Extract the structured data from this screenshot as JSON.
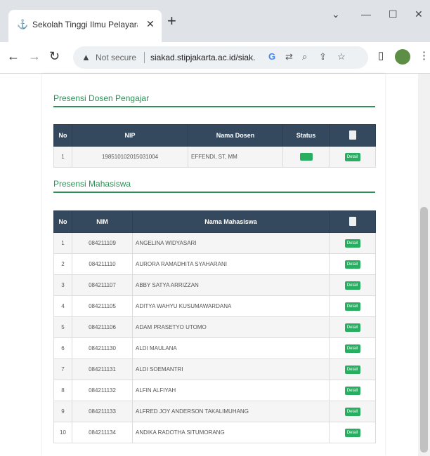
{
  "browser": {
    "tab_title": "Sekolah Tinggi Ilmu Pelayaran J...",
    "tab_favicon": "anchor-icon",
    "new_tab_symbol": "+",
    "not_secure_label": "Not secure",
    "url": "siakad.stipjakarta.ac.id/siak..."
  },
  "page": {
    "dosen_section_title": "Presensi Dosen Pengajar",
    "mahasiswa_section_title": "Presensi Mahasiswa",
    "dosen_table": {
      "headers": {
        "no": "No",
        "nip": "NIP",
        "nama": "Nama Dosen",
        "status": "Status"
      },
      "rows": [
        {
          "no": "1",
          "nip": "198510102015031004",
          "nama": "EFFENDI, ST, MM"
        }
      ]
    },
    "mahasiswa_table": {
      "headers": {
        "no": "No",
        "nim": "NIM",
        "nama": "Nama Mahasiswa"
      },
      "rows": [
        {
          "no": "1",
          "nim": "084211109",
          "nama": "ANGELINA WIDYASARI"
        },
        {
          "no": "2",
          "nim": "084211110",
          "nama": "AURORA RAMADHITA SYAHARANI"
        },
        {
          "no": "3",
          "nim": "084211107",
          "nama": "ABBY SATYA ARRIZZAN"
        },
        {
          "no": "4",
          "nim": "084211105",
          "nama": "ADITYA WAHYU KUSUMAWARDANA"
        },
        {
          "no": "5",
          "nim": "084211106",
          "nama": "ADAM PRASETYO UTOMO"
        },
        {
          "no": "6",
          "nim": "084211130",
          "nama": "ALDI MAULANA"
        },
        {
          "no": "7",
          "nim": "084211131",
          "nama": "ALDI SOEMANTRI"
        },
        {
          "no": "8",
          "nim": "084211132",
          "nama": "ALFIN ALFIYAH"
        },
        {
          "no": "9",
          "nim": "084211133",
          "nama": "ALFRED JOY ANDERSON TAKALIMUHANG"
        },
        {
          "no": "10",
          "nim": "084211134",
          "nama": "ANDIKA RADOTHA SITUMORANG"
        }
      ]
    },
    "action_label": "Detail"
  },
  "colors": {
    "accent_green": "#2f8f58",
    "header_navy": "#34495e",
    "button_green": "#27ae60"
  }
}
